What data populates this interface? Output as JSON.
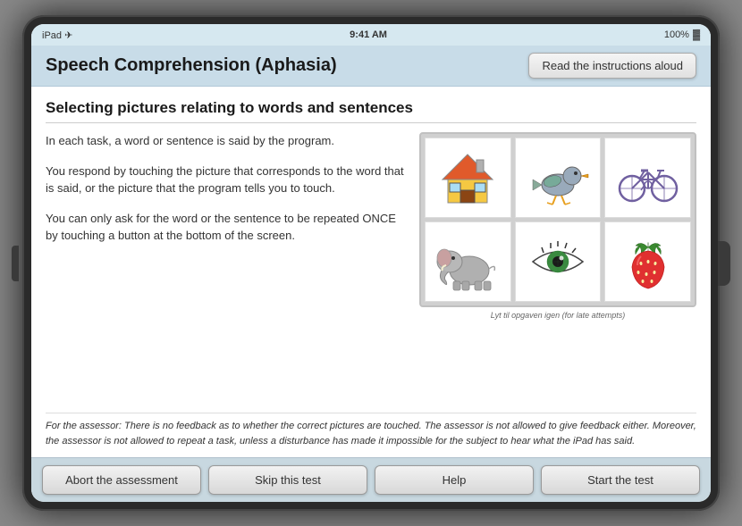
{
  "device": {
    "status_bar": {
      "left": "iPad ✈",
      "time": "9:41 AM",
      "battery": "100%"
    }
  },
  "header": {
    "title": "Speech Comprehension (Aphasia)",
    "read_aloud_btn": "Read the instructions aloud"
  },
  "content": {
    "section_title": "Selecting pictures relating to words and sentences",
    "instructions": [
      "In each task, a word or sentence is said by the program.",
      "You respond by touching the picture that corresponds to the word that is said, or the picture that the program tells you to touch.",
      "You can only ask for the word or the sentence to be repeated ONCE by touching a button at the bottom of the screen."
    ],
    "image_caption": "Lyt til opgaven igen (for late attempts)",
    "italic_note": "For the assessor: There is no feedback as to whether the correct pictures are touched. The assessor is not allowed to give feedback either. Moreover, the assessor is not allowed to repeat a task, unless a disturbance has made it impossible for the subject to hear what the iPad has said."
  },
  "toolbar": {
    "abort_btn": "Abort the assessment",
    "skip_btn": "Skip this test",
    "help_btn": "Help",
    "start_btn": "Start the test"
  }
}
